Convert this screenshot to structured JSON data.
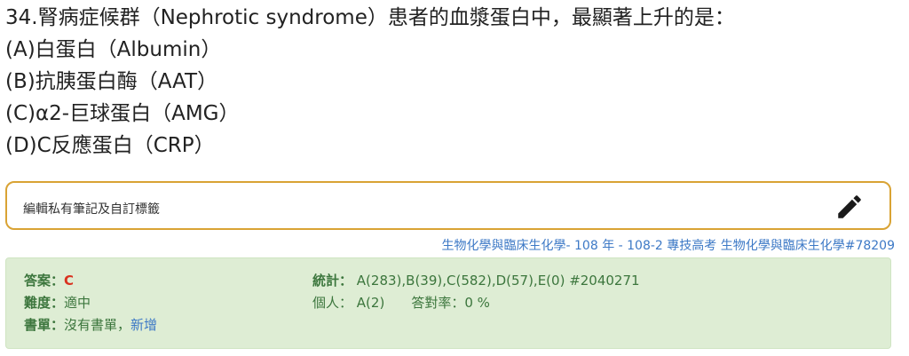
{
  "question": {
    "stem": "34.腎病症候群（Nephrotic syndrome）患者的血漿蛋白中，最顯著上升的是：",
    "options": [
      "(A)白蛋白（Albumin）",
      "(B)抗胰蛋白酶（AAT）",
      "(C)α2-巨球蛋白（AMG）",
      "(D)C反應蛋白（CRP）"
    ]
  },
  "note": {
    "placeholder": "編輯私有筆記及自訂標籤",
    "edit_icon": "pencil-icon"
  },
  "source_link": "生物化學與臨床生化學- 108 年 - 108-2 專技高考 生物化學與臨床生化學#78209",
  "info": {
    "answer_label": "答案：",
    "answer_value": "C",
    "difficulty_label": "難度：",
    "difficulty_value": "適中",
    "booklist_label": "書單：",
    "booklist_value": "沒有書單，",
    "booklist_add": "新增",
    "stats_label": "統計：",
    "stats_value": "A(283),B(39),C(582),D(57),E(0) #2040271",
    "personal_label": "個人：",
    "personal_value": "A(2)",
    "accuracy_label": "答對率：",
    "accuracy_value": "0 %"
  },
  "colors": {
    "note_border": "#d9a334",
    "info_bg": "#deedd4",
    "info_text": "#3c763d",
    "answer": "#d9321f",
    "link": "#3d79c6"
  }
}
